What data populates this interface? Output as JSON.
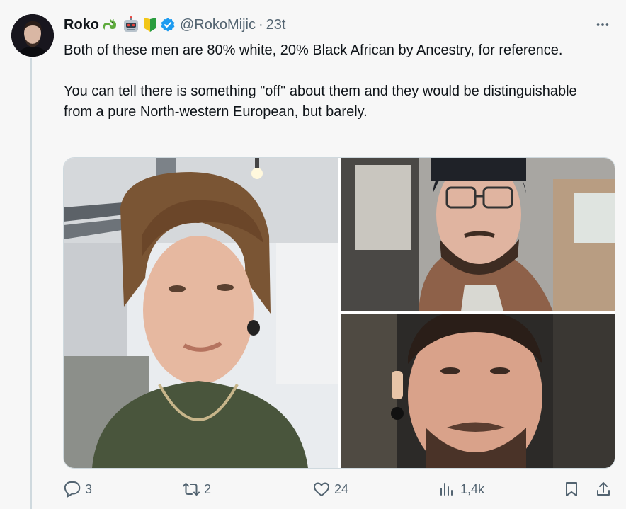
{
  "author": {
    "name": "Roko",
    "badges": [
      "dragon-emoji",
      "robot-emoji",
      "beginner-emoji",
      "verified-badge"
    ],
    "handle": "@RokoMijic",
    "separator": "·",
    "time": "23t"
  },
  "tweet": {
    "text": "Both of these men are 80% white, 20% Black African by Ancestry, for reference.\n\nYou can tell there is something \"off\" about them and they would be distinguishable from a pure North-western European, but barely."
  },
  "media": {
    "photos": [
      "selfie-indoor",
      "selfie-car-glasses",
      "selfie-lying-down"
    ]
  },
  "actions": {
    "replies": "3",
    "reposts": "2",
    "likes": "24",
    "views": "1,4k"
  },
  "colors": {
    "text": "#0f1419",
    "muted": "#536471",
    "verified": "#1d9bf0",
    "background": "#f7f7f7"
  }
}
